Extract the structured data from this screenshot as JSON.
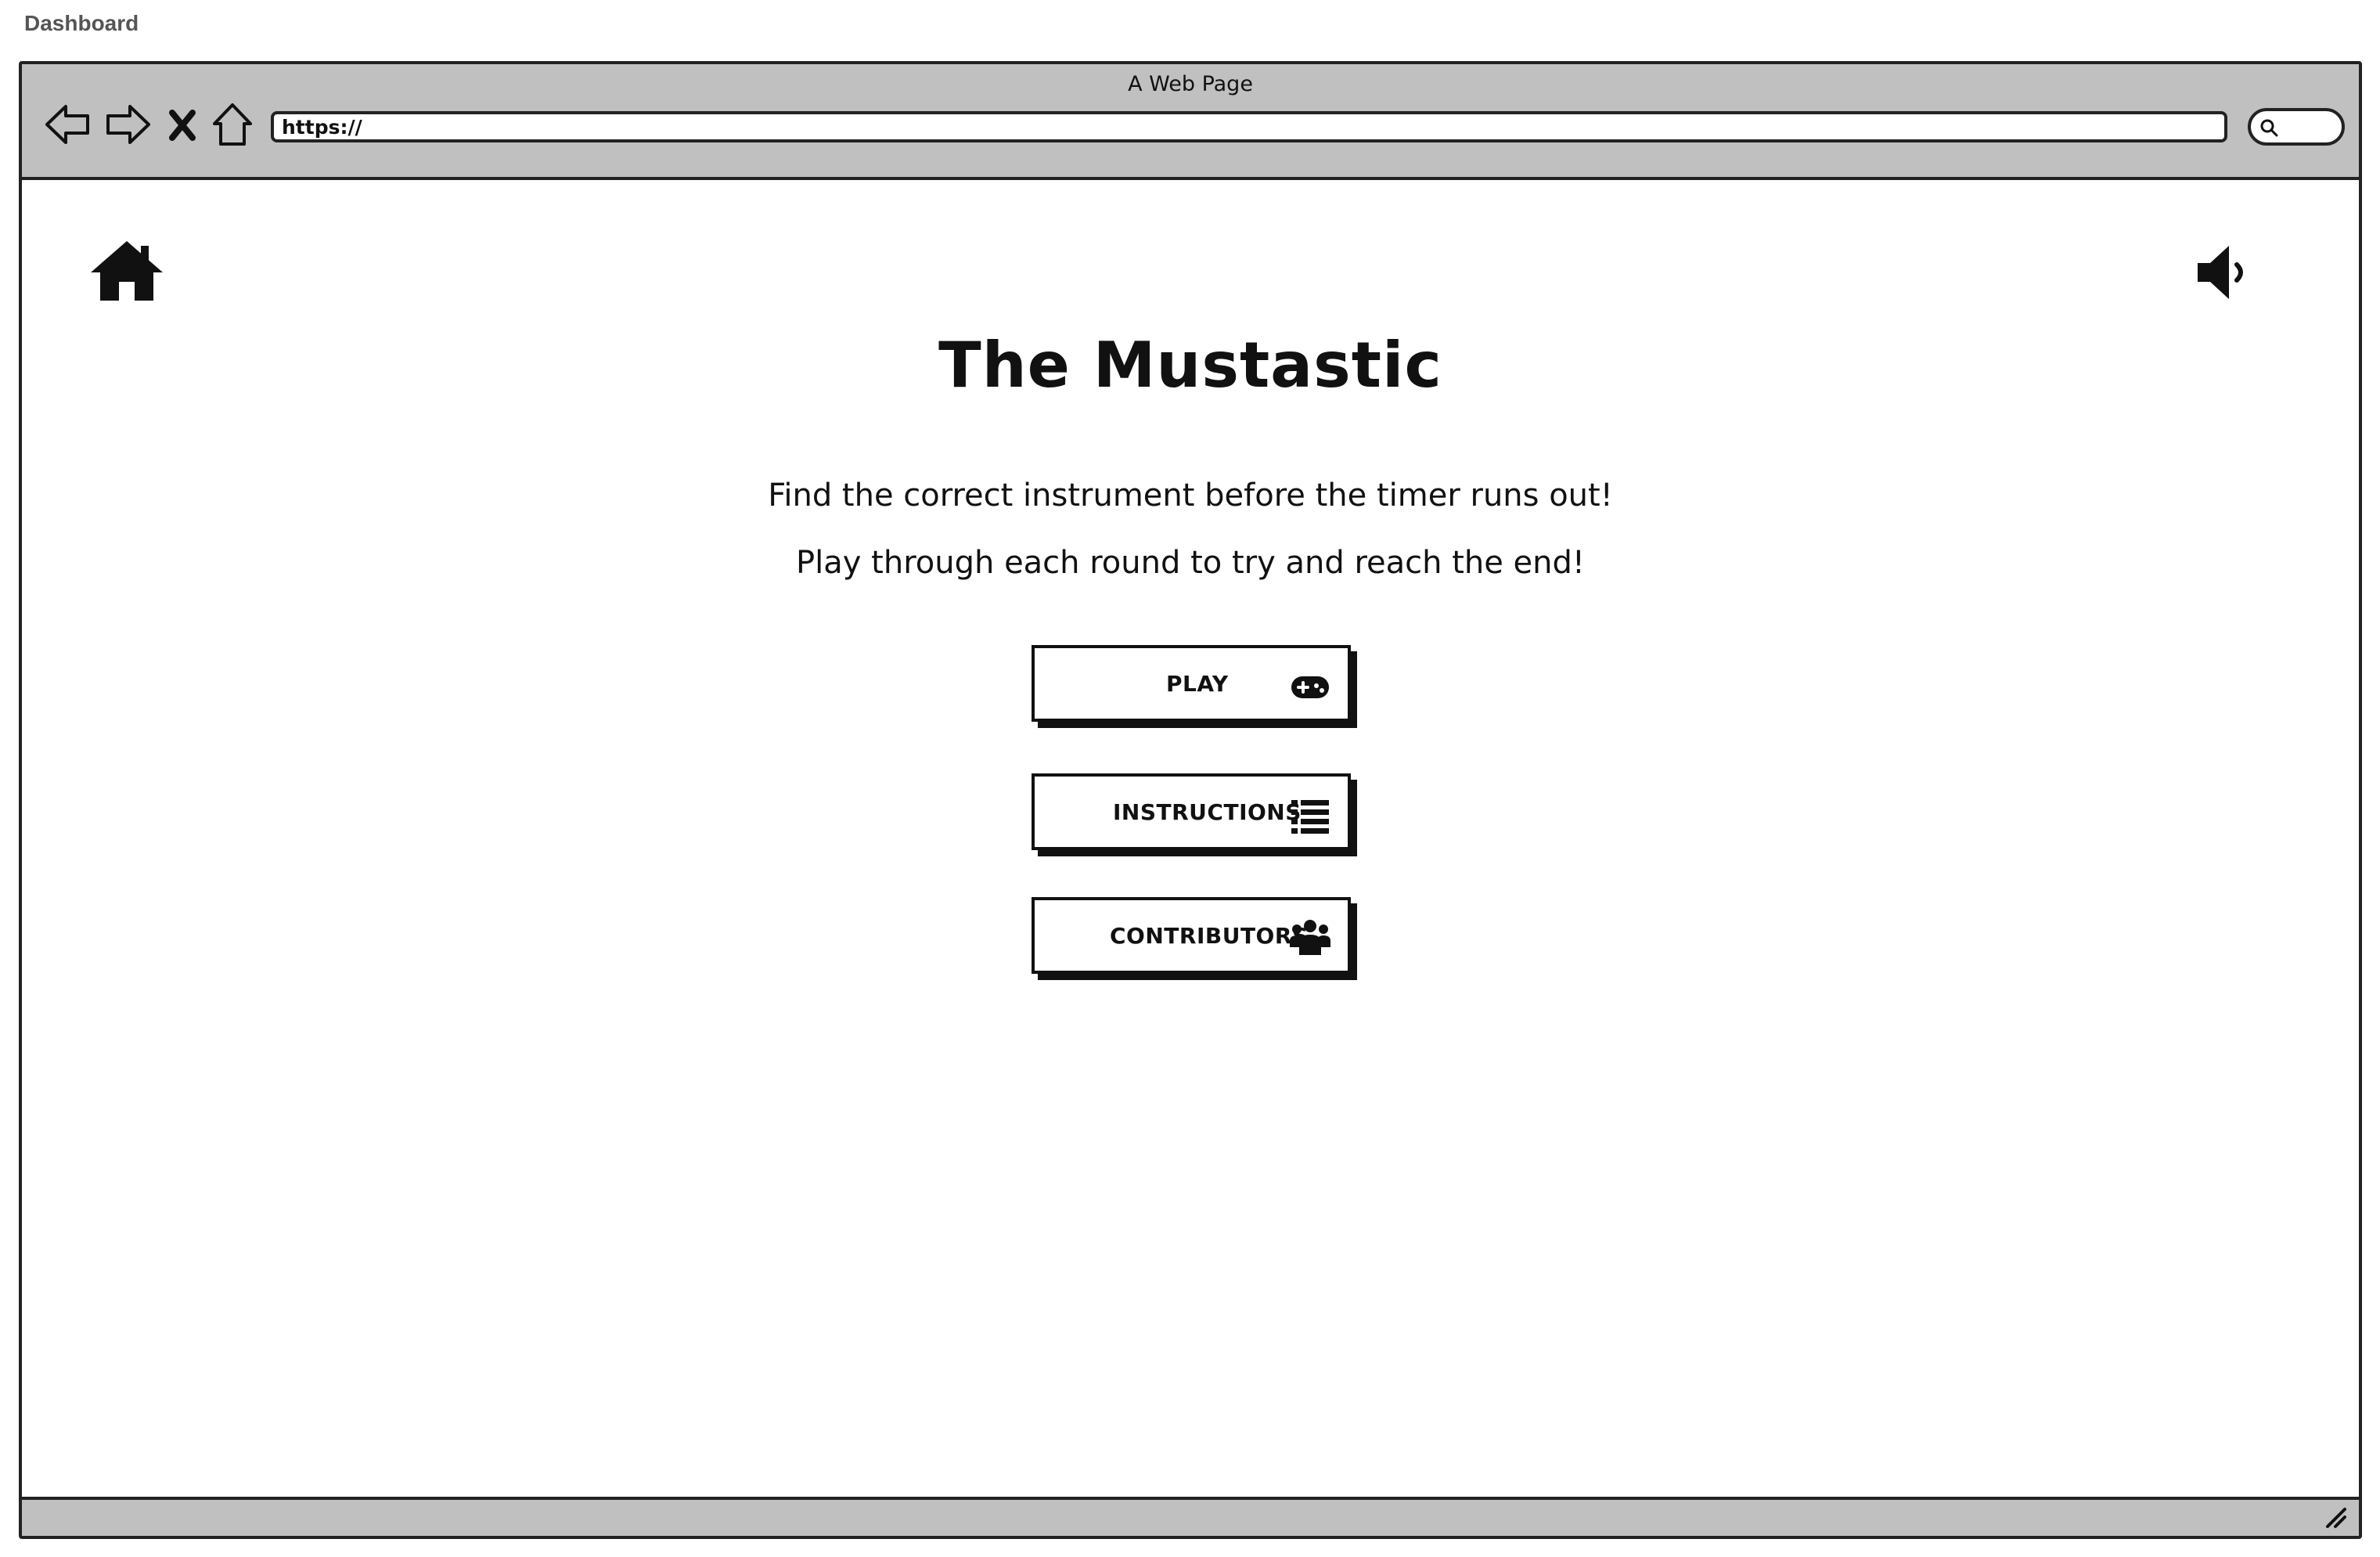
{
  "app": {
    "top_label": "Dashboard"
  },
  "browser": {
    "window_title": "A Web Page",
    "url": "https://",
    "icons": [
      "back-arrow-icon",
      "forward-arrow-icon",
      "close-x-icon",
      "home-outline-icon",
      "search-icon",
      "resize-grip-icon"
    ]
  },
  "page": {
    "title": "The Mustastic",
    "subtitle_1": "Find the correct instrument before the timer runs out!",
    "subtitle_2": "Play through each round to try and reach the end!",
    "header_icons": [
      "home-icon",
      "volume-icon"
    ]
  },
  "menu": {
    "buttons": [
      {
        "label": "PLAY",
        "icon": "gamepad-icon"
      },
      {
        "label": "INSTRUCTIONS",
        "icon": "list-icon"
      },
      {
        "label": "CONTRIBUTORS",
        "icon": "users-icon"
      }
    ]
  },
  "colors": {
    "chrome": "#c0c0c0",
    "border": "#222222",
    "background": "#ffffff",
    "text": "#111111"
  }
}
